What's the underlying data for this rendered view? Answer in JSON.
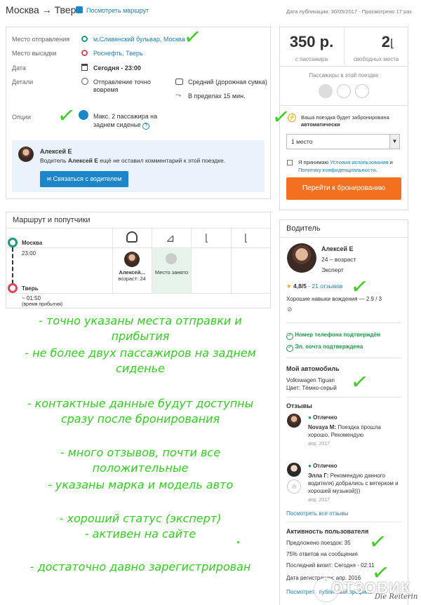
{
  "header": {
    "route": "Москва → Тверь",
    "map_link": "Посмотреть маршрут",
    "meta": "Дата публикации: 30/05/2017 - Просмотрено 17 раз"
  },
  "trip": {
    "departure_label": "Место отправления",
    "departure_value": "м.Славянский бульвар, Москва",
    "dropoff_label": "Место высадки",
    "dropoff_value": "Роснефть, Тверь",
    "date_label": "Дата",
    "date_value": "Сегодня - 23:00",
    "details_label": "Детали",
    "detail_punctual": "Отправление точно вовремя",
    "detail_luggage": "Средний (дорожная сумка)",
    "detail_detour": "В пределах 15 мин.",
    "options_label": "Опции",
    "options_value": "Макс. 2 пассажира на заднем сиденье",
    "options_help": "?"
  },
  "driver_comment": {
    "name": "Алексей Е",
    "text_prefix": "Водитель ",
    "text_name": "Алексей Е",
    "text_suffix": " ещё не оставил комментарий к этой поездке.",
    "contact_button": "Связаться с водителем"
  },
  "booking": {
    "price": "350 р.",
    "price_caption": "с пассажира",
    "seats": "2",
    "seats_caption": "свободных места",
    "passengers_caption": "Пассажиры в этой поездке",
    "auto_text_1": "Ваша поездка будет забронирована",
    "auto_text_2": "автоматически",
    "seat_select_value": "1 место",
    "terms_prefix": "Я принимаю ",
    "terms_link": "Условия использования",
    "terms_and": " и",
    "privacy_link": "Политику конфиденциальности",
    "privacy_suffix": ".",
    "book_button": "Перейти к бронированию"
  },
  "route_panel": {
    "title": "Маршрут и попутчики",
    "from_city": "Москва",
    "from_time": "23:00",
    "to_city": "Тверь",
    "to_time": "~ 01:50",
    "arrival_note": "(время прибытия)",
    "passenger_name": "Алексей...",
    "passenger_age": "возраст: 24",
    "seat_taken": "Место занято"
  },
  "driver_panel": {
    "title": "Водитель",
    "name": "Алексей Е",
    "age": "24 – возраст",
    "level": "Эксперт",
    "rating": "4,8/5",
    "reviews_count": " - 21 отзывов",
    "driving_skill": "Хорошие навыки вождения — 2.9 / 3",
    "phone_verified": "Номер телефона подтверждён",
    "email_verified": "Эл. почта подтверждена",
    "car_title": "Мой автомобиль",
    "car_model": "Volkswagen Tiguan",
    "car_color": "Цвет: Тёмно-серый",
    "reviews_title": "Отзывы",
    "review1_rating": "Отлично",
    "review1_author": "Novaya M:",
    "review1_text": " Поездка прошла хорошо. Рекомендую",
    "review1_date": "апр. 2017",
    "review2_rating": "Отлично",
    "review2_author": "Элла Г:",
    "review2_text": " Рекомендую данного водителя) добрались с ветерком и хорошей музыкой)))",
    "review2_date": "апр. 2017",
    "all_reviews": "Посмотреть все отзывы",
    "activity_title": "Активность пользователя",
    "trips_offered": "Предложено поездок: 35",
    "response_rate": "75% ответов на сообщения",
    "last_visit": "Последний визит: Сегодня - 02:11",
    "registered": "Дата регистрации: апр. 2016",
    "public_profile": "Посмотреть публичный профиль"
  },
  "annotations": {
    "line1": "- точно указаны места отправки и",
    "line2": "прибытия",
    "line3": "- не более двух пассажиров на заднем",
    "line4": "сиденье",
    "line5": "- контактные данные будут доступны",
    "line6": "сразу после бронирования",
    "line7": "- много отзывов, почти все",
    "line8": "положительные",
    "line9": "- указаны марка и модель авто",
    "line10": "- хороший статус (эксперт)",
    "line11": "- активен на сайте",
    "line12": "- достаточно давно зарегистрирован"
  },
  "watermark": {
    "brand": "ОТЗОВИК",
    "author": "Die Reiterin"
  },
  "colors": {
    "accent_blue": "#1b86c9",
    "accent_orange": "#f37021",
    "handwriting_green": "#2fd11c",
    "verified_green": "#1a9b4c"
  }
}
